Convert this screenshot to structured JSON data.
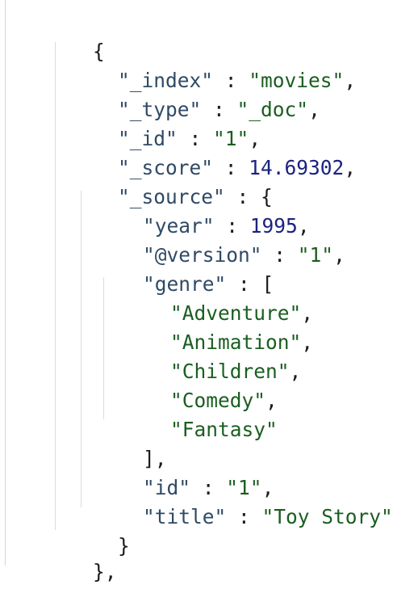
{
  "document": {
    "open_brace": "{",
    "index_key": "\"_index\"",
    "index_value": "\"movies\"",
    "type_key": "\"_type\"",
    "type_value": "\"_doc\"",
    "id_key": "\"_id\"",
    "id_value": "\"1\"",
    "score_key": "\"_score\"",
    "score_value": "14.69302",
    "source_key": "\"_source\"",
    "source": {
      "year_key": "\"year\"",
      "year_value": "1995",
      "version_key": "\"@version\"",
      "version_value": "\"1\"",
      "genre_key": "\"genre\"",
      "genres": [
        "\"Adventure\"",
        "\"Animation\"",
        "\"Children\"",
        "\"Comedy\"",
        "\"Fantasy\""
      ],
      "id_key": "\"id\"",
      "id_value": "\"1\"",
      "title_key": "\"title\"",
      "title_value": "\"Toy Story\""
    },
    "close_source": "}",
    "close_doc": "},"
  },
  "colors": {
    "key": "#2f4a66",
    "string": "#1b5e20",
    "number": "#1a237e"
  }
}
